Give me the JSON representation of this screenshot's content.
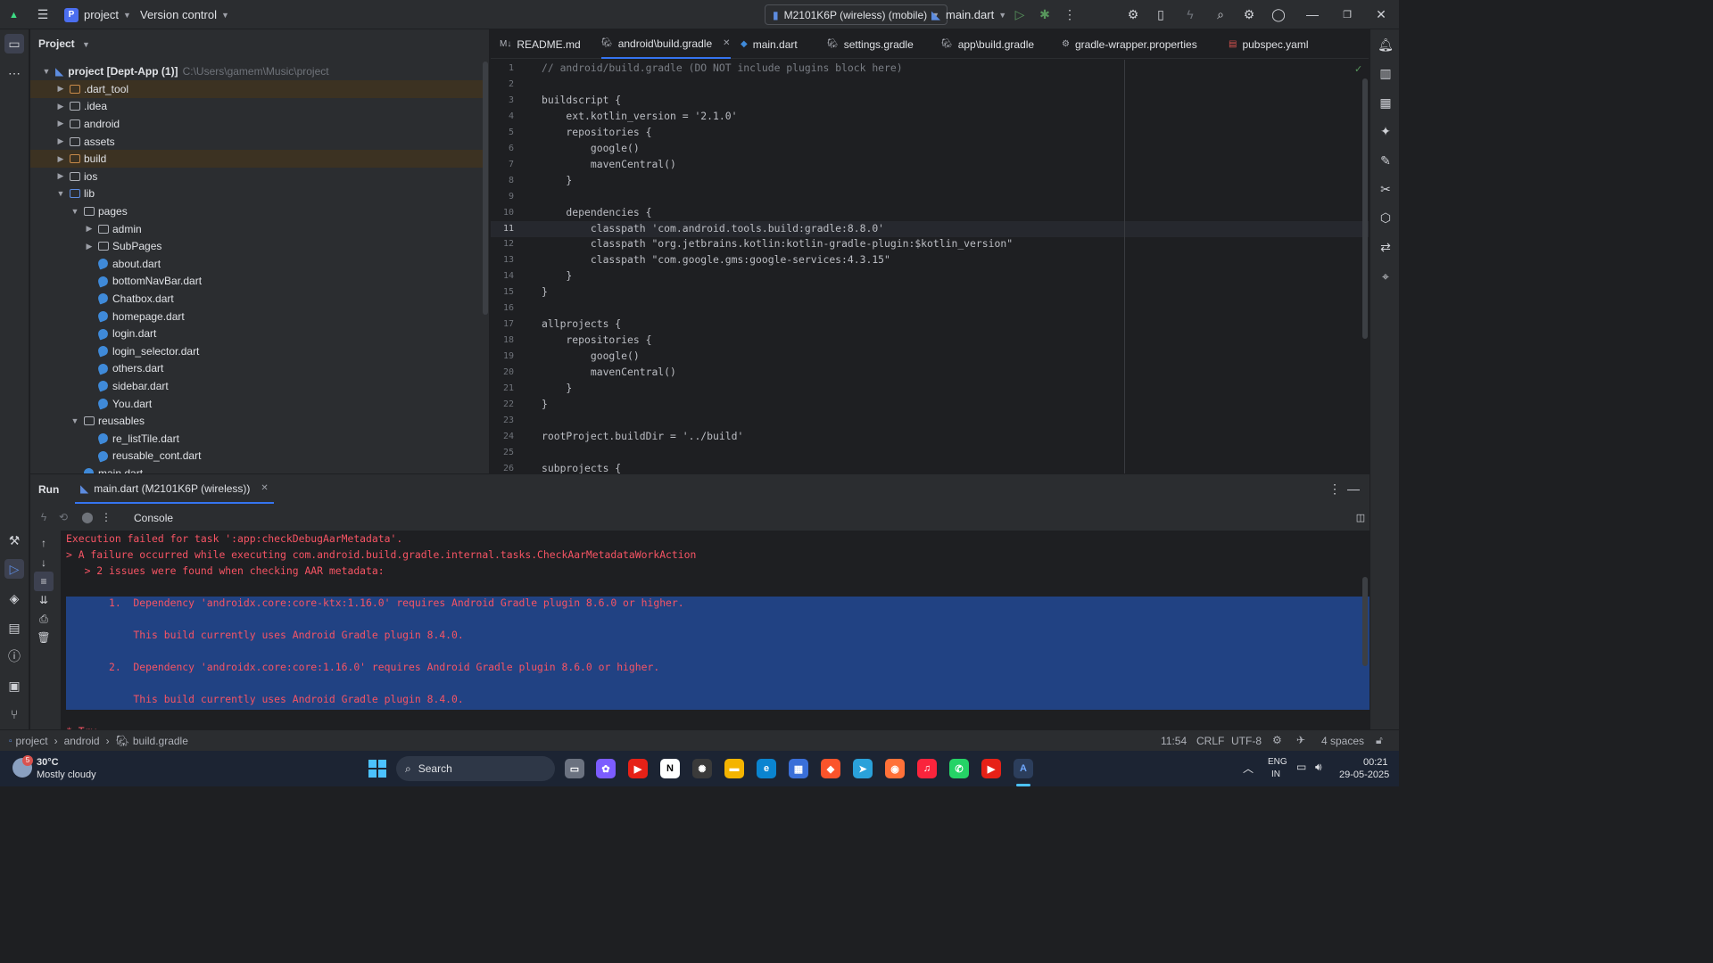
{
  "titlebar": {
    "project_badge": "P",
    "project_name": "project",
    "version_control": "Version control",
    "device": "M2101K6P (wireless) (mobile)",
    "run_config": "main.dart"
  },
  "project_panel": {
    "title": "Project",
    "root_label": "project [Dept-App (1)]",
    "root_path": "C:\\Users\\gamem\\Music\\project",
    "items": [
      {
        "label": ".dart_tool",
        "depth": 1,
        "kind": "folder-orange",
        "expander": "closed",
        "highlight": true
      },
      {
        "label": ".idea",
        "depth": 1,
        "kind": "folder",
        "expander": "closed"
      },
      {
        "label": "android",
        "depth": 1,
        "kind": "folder",
        "expander": "closed"
      },
      {
        "label": "assets",
        "depth": 1,
        "kind": "folder",
        "expander": "closed"
      },
      {
        "label": "build",
        "depth": 1,
        "kind": "folder-orange",
        "expander": "closed",
        "highlight": true
      },
      {
        "label": "ios",
        "depth": 1,
        "kind": "folder",
        "expander": "closed"
      },
      {
        "label": "lib",
        "depth": 1,
        "kind": "folder-blue",
        "expander": "open"
      },
      {
        "label": "pages",
        "depth": 2,
        "kind": "folder",
        "expander": "open"
      },
      {
        "label": "admin",
        "depth": 3,
        "kind": "folder",
        "expander": "closed"
      },
      {
        "label": "SubPages",
        "depth": 3,
        "kind": "folder",
        "expander": "closed"
      },
      {
        "label": "about.dart",
        "depth": 3,
        "kind": "dart"
      },
      {
        "label": "bottomNavBar.dart",
        "depth": 3,
        "kind": "dart"
      },
      {
        "label": "Chatbox.dart",
        "depth": 3,
        "kind": "dart"
      },
      {
        "label": "homepage.dart",
        "depth": 3,
        "kind": "dart"
      },
      {
        "label": "login.dart",
        "depth": 3,
        "kind": "dart"
      },
      {
        "label": "login_selector.dart",
        "depth": 3,
        "kind": "dart"
      },
      {
        "label": "others.dart",
        "depth": 3,
        "kind": "dart"
      },
      {
        "label": "sidebar.dart",
        "depth": 3,
        "kind": "dart"
      },
      {
        "label": "You.dart",
        "depth": 3,
        "kind": "dart"
      },
      {
        "label": "reusables",
        "depth": 2,
        "kind": "folder",
        "expander": "open"
      },
      {
        "label": "re_listTile.dart",
        "depth": 3,
        "kind": "dart"
      },
      {
        "label": "reusable_cont.dart",
        "depth": 3,
        "kind": "dart"
      },
      {
        "label": "main.dart",
        "depth": 2,
        "kind": "dart"
      }
    ]
  },
  "editor": {
    "tabs": [
      {
        "label": "README.md",
        "icon": "M↓"
      },
      {
        "label": "android\\build.gradle",
        "icon": "gradle",
        "active": true
      },
      {
        "label": "main.dart",
        "icon": "dart"
      },
      {
        "label": "settings.gradle",
        "icon": "gradle"
      },
      {
        "label": "app\\build.gradle",
        "icon": "gradle"
      },
      {
        "label": "gradle-wrapper.properties",
        "icon": "gear"
      },
      {
        "label": "pubspec.yaml",
        "icon": "yaml"
      }
    ],
    "current_line": 11,
    "lines": [
      "// android/build.gradle (DO NOT include plugins block here)",
      "",
      "buildscript {",
      "    ext.kotlin_version = '2.1.0'",
      "    repositories {",
      "        google()",
      "        mavenCentral()",
      "    }",
      "",
      "    dependencies {",
      "        classpath 'com.android.tools.build:gradle:8.8.0'",
      "        classpath \"org.jetbrains.kotlin:kotlin-gradle-plugin:$kotlin_version\"",
      "        classpath \"com.google.gms:google-services:4.3.15\"",
      "    }",
      "}",
      "",
      "allprojects {",
      "    repositories {",
      "        google()",
      "        mavenCentral()",
      "    }",
      "}",
      "",
      "rootProject.buildDir = '../build'",
      "",
      "subprojects {"
    ]
  },
  "run_panel": {
    "title": "Run",
    "tab_label": "main.dart (M2101K6P (wireless))",
    "console_label": "Console",
    "lines": [
      {
        "text": "Execution failed for task ':app:checkDebugAarMetadata'.",
        "selected": false
      },
      {
        "text": "> A failure occurred while executing com.android.build.gradle.internal.tasks.CheckAarMetadataWorkAction",
        "selected": false
      },
      {
        "text": "   > 2 issues were found when checking AAR metadata:",
        "selected": false
      },
      {
        "text": "",
        "selected": false
      },
      {
        "text": "       1.  Dependency 'androidx.core:core-ktx:1.16.0' requires Android Gradle plugin 8.6.0 or higher.",
        "selected": true
      },
      {
        "text": "",
        "selected": true
      },
      {
        "text": "           This build currently uses Android Gradle plugin 8.4.0.",
        "selected": true
      },
      {
        "text": "",
        "selected": true
      },
      {
        "text": "       2.  Dependency 'androidx.core:core:1.16.0' requires Android Gradle plugin 8.6.0 or higher.",
        "selected": true
      },
      {
        "text": "",
        "selected": true
      },
      {
        "text": "           This build currently uses Android Gradle plugin 8.4.0.",
        "selected": true
      },
      {
        "text": "",
        "selected": false
      },
      {
        "text": "* Try:",
        "selected": false
      }
    ]
  },
  "statusbar": {
    "breadcrumb": [
      "project",
      "android",
      "build.gradle"
    ],
    "position": "11:54",
    "line_sep": "CRLF",
    "encoding": "UTF-8",
    "indent": "4 spaces"
  },
  "taskbar": {
    "weather_temp": "30°C",
    "weather_desc": "Mostly cloudy",
    "weather_badge": "5",
    "search": "Search",
    "lang_top": "ENG",
    "lang_bottom": "IN",
    "time": "00:21",
    "date": "29-05-2025"
  }
}
